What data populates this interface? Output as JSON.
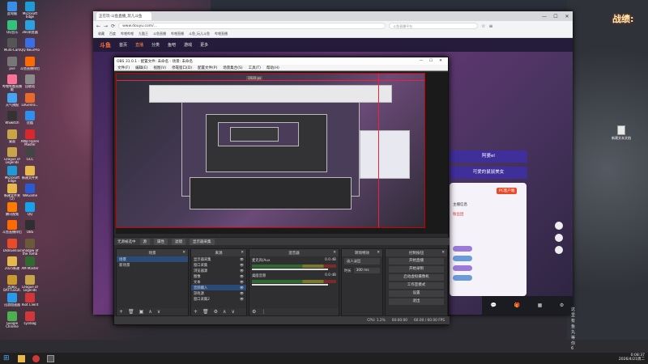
{
  "desktop": {
    "icons": [
      {
        "label": "此电脑",
        "color": "#3a8ee6"
      },
      {
        "label": "Microsoft Edge",
        "color": "#1f9ad6"
      },
      {
        "label": "QQ音乐",
        "color": "#31c27c"
      },
      {
        "label": "360浏览器",
        "color": "#2aa1e0"
      },
      {
        "label": "Multi-Cam",
        "color": "#555555"
      },
      {
        "label": "QQ NeurPro",
        "color": "#3a6ee6"
      },
      {
        "label": "pve",
        "color": "#777777"
      },
      {
        "label": "斗鱼直播伴侣",
        "color": "#ff6a00"
      },
      {
        "label": "哔哩哔哩直播姬",
        "color": "#fb7299"
      },
      {
        "label": "回收站",
        "color": "#8a8a8a"
      },
      {
        "label": "天气预报",
        "color": "#47a3f3"
      },
      {
        "label": "LeGenFa...",
        "color": "#e8692c"
      },
      {
        "label": "WSwitch",
        "color": "#333333"
      },
      {
        "label": "优酷",
        "color": "#2f8ff0"
      },
      {
        "label": "桌面",
        "color": "#c9a34a"
      },
      {
        "label": "AMD Ryzen Master",
        "color": "#d8272d"
      },
      {
        "label": "League of Legends",
        "color": "#c8a44a"
      },
      {
        "label": "GCC",
        "color": "#444444"
      },
      {
        "label": "Microsoft Edge",
        "color": "#1f9ad6"
      },
      {
        "label": "新建文件夹",
        "color": "#e8b84a"
      },
      {
        "label": "新建文件夹 (2)",
        "color": "#e8b84a"
      },
      {
        "label": "WeGame",
        "color": "#2a5bd7"
      },
      {
        "label": "腾讯视频",
        "color": "#ff7a00"
      },
      {
        "label": "QQ",
        "color": "#18a0ea"
      },
      {
        "label": "斗鱼直播伴侣",
        "color": "#ff6a00"
      },
      {
        "label": "OBS",
        "color": "#302e31"
      },
      {
        "label": "DiskGenius",
        "color": "#e84a2a"
      },
      {
        "label": "Shadow of the Tomb",
        "color": "#6b5a3a"
      },
      {
        "label": "2025新建",
        "color": "#e8b84a"
      },
      {
        "label": "AM Master",
        "color": "#2f6a2f"
      },
      {
        "label": "PUBG BATTLEGR.",
        "color": "#c99a2e"
      },
      {
        "label": "League of Legends",
        "color": "#c8a44a"
      },
      {
        "label": "迅游加速器",
        "color": "#2a9ae8"
      },
      {
        "label": "Riot Client",
        "color": "#d13639"
      },
      {
        "label": "Google Chrome",
        "color": "#4caf50"
      },
      {
        "label": "sysdiag",
        "color": "#d13639"
      }
    ],
    "right_icon_label": "新建文本文档",
    "overlay_text": "战绩:"
  },
  "browser": {
    "tab_title": "正在玩-斗鱼直播_玩儿斗鱼",
    "url": "www.douyu.com/...",
    "search_placeholder": "斗鱼直播平台",
    "bookmarks": [
      "收藏",
      "百度",
      "哔哩哔哩",
      "九酷王",
      "斗鱼直播",
      "哔哩直播",
      "斗鱼_玩儿斗鱼",
      "哔哩直播"
    ],
    "site_nav": [
      "首页",
      "直播",
      "分类",
      "鱼吧",
      "游戏",
      "更多"
    ],
    "right_buttons": [
      "阿婆el",
      "可爱的鼠鼠美女"
    ],
    "panel_items": [
      "PC客户端",
      "主播信息",
      "粉丝团",
      "火箭",
      "礼物",
      "贡献榜"
    ],
    "ticker_text": "这里有鱼丸等你6"
  },
  "obs": {
    "title": "OBS 31.0.1 - 配置文件: 未命名 - 场景: 未命名",
    "menu": [
      "文件(F)",
      "编辑(E)",
      "视图(V)",
      "停靠窗口(D)",
      "配置文件(P)",
      "场景集合(S)",
      "工具(T)",
      "帮助(H)"
    ],
    "canvas_size_label": "1920 px",
    "tool_buttons": [
      "源",
      "属性",
      "滤镜",
      "显示器采集"
    ],
    "no_source": "无源被选中",
    "docks": {
      "scenes": "场景",
      "sources": "来源",
      "mixer": "混音器",
      "transitions": "转场特效",
      "controls": "控制按钮"
    },
    "scenes": [
      "场景",
      "新场景"
    ],
    "sources": [
      "显示器采集",
      "窗口采集",
      "浏览器源",
      "图像",
      "文本",
      "音频输入",
      "游戏源",
      "窗口采集2"
    ],
    "mixer": [
      {
        "name": "桌面音频",
        "db": "0.0 dB"
      },
      {
        "name": "麦克风/Aux",
        "db": "0.0 dB"
      }
    ],
    "transition": {
      "type": "淡入淡出",
      "duration_label": "时长",
      "duration": "300 ms"
    },
    "controls": [
      "开始直播",
      "开始录制",
      "启动虚拟摄像机",
      "工作室模式",
      "设置",
      "退出"
    ],
    "status": [
      "CPU: 1.2%",
      "00:00:00",
      "60.00 / 60.00 FPS"
    ]
  },
  "taskbar": {
    "time": "0:08:37",
    "date": "2026/4/21周二"
  }
}
